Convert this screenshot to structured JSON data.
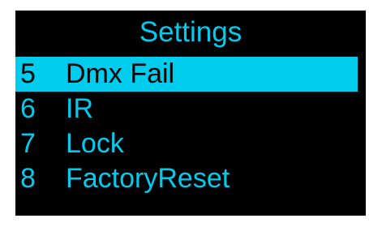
{
  "screen": {
    "title": "Settings",
    "colors": {
      "background": "#000000",
      "foreground": "#00ccee",
      "highlight": "#00ccee",
      "highlight_text": "#000000"
    },
    "menu": [
      {
        "number": "5",
        "label": "Dmx Fail",
        "selected": true
      },
      {
        "number": "6",
        "label": "IR",
        "selected": false
      },
      {
        "number": "7",
        "label": "Lock",
        "selected": false
      },
      {
        "number": "8",
        "label": "FactoryReset",
        "selected": false
      }
    ]
  }
}
